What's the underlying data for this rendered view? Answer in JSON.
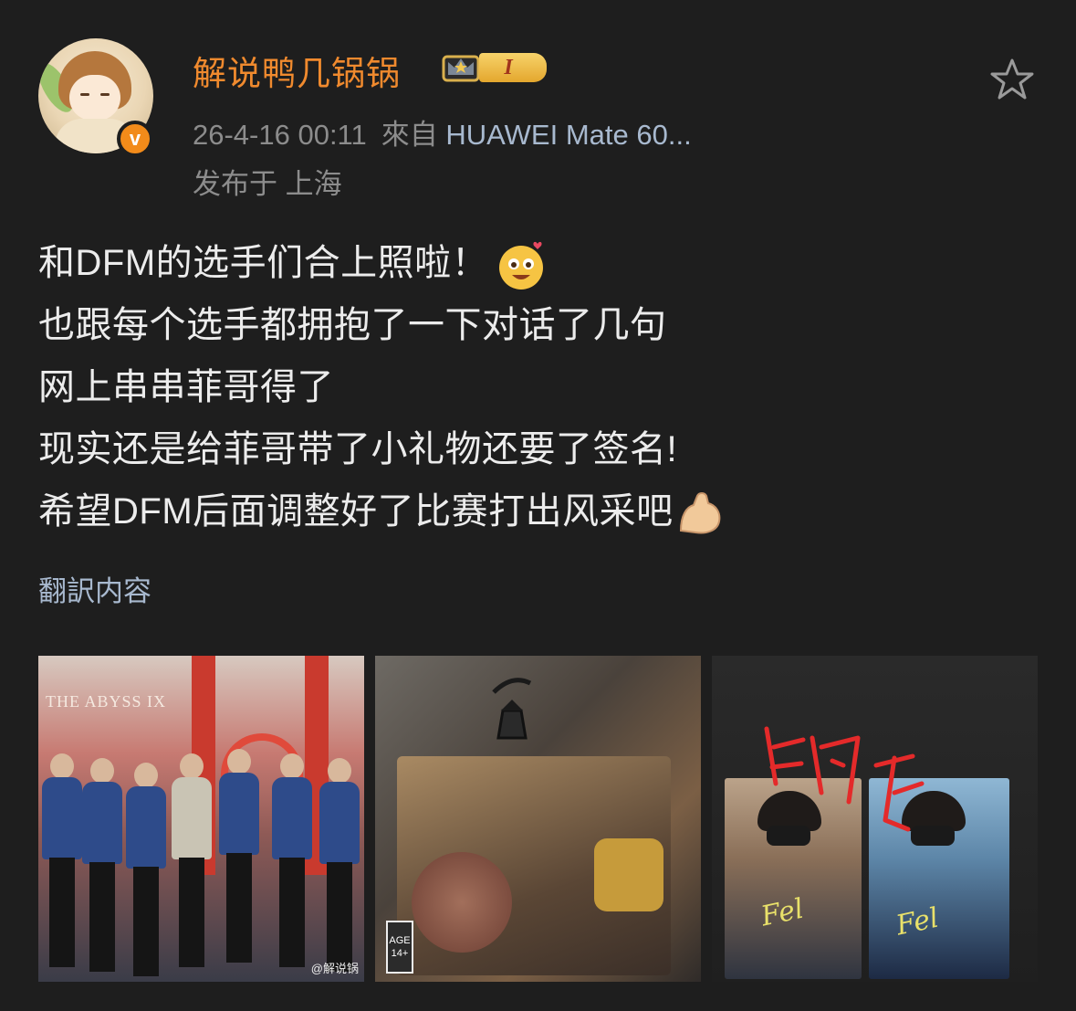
{
  "post": {
    "username": "解说鸭几锅锅",
    "level": "I",
    "verified_mark": "v",
    "timestamp": "26-4-16 00:11",
    "source_prefix": "來自",
    "device": "HUAWEI Mate 60...",
    "location": "发布于 上海",
    "lines": [
      "和DFM的选手们合上照啦！",
      "也跟每个选手都拥抱了一下对话了几句",
      "网上串串菲哥得了",
      "现实还是给菲哥带了小礼物还要了签名!",
      "希望DFM后面调整好了比赛打出风采吧"
    ],
    "translate_label": "翻訳内容",
    "favorite_icon": "star-outline-icon"
  },
  "photos": [
    {
      "name": "team-photo",
      "text": "THE ABYSS IX",
      "watermark": "@解说锅"
    },
    {
      "name": "gift-photo",
      "age_label": "AGE",
      "age_value": "14+"
    },
    {
      "name": "signed-cards-photo",
      "scribble": "FK"
    }
  ],
  "colors": {
    "background": "#1e1e1e",
    "username": "#f08a2e",
    "link": "#a8b9cf",
    "meta": "#8c8c8c",
    "text": "#ececec"
  }
}
